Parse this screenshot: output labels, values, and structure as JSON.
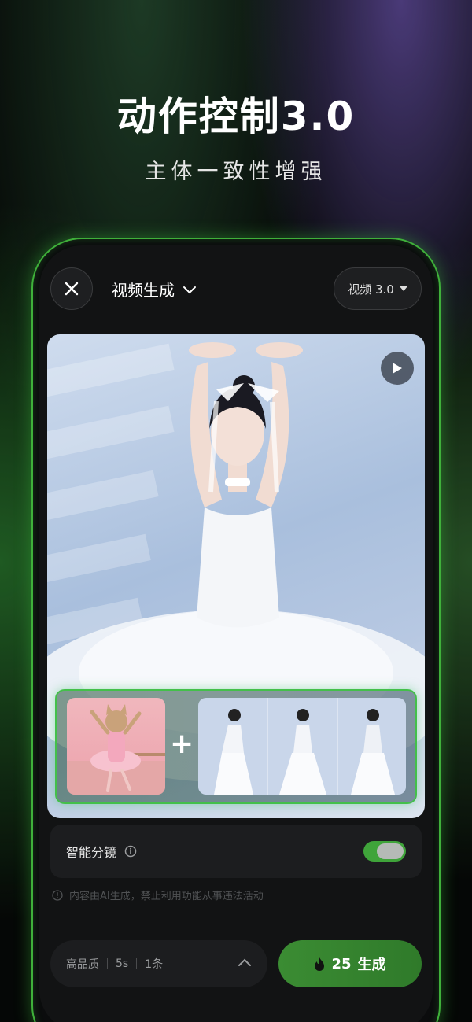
{
  "promo": {
    "headline": "动作控制3.0",
    "subline": "主体一致性增强"
  },
  "header": {
    "close_icon": "close-icon",
    "mode_title": "视频生成",
    "version_label": "视频 3.0"
  },
  "media": {
    "play_icon": "play-icon"
  },
  "combo": {
    "plus": "+"
  },
  "options": {
    "smart_shot_label": "智能分镜",
    "smart_shot_on": true
  },
  "disclaimer": "内容由AI生成，禁止利用功能从事违法活动",
  "footer": {
    "quality": "高品质",
    "duration": "5s",
    "count": "1条",
    "credits": "25",
    "generate_label": "生成"
  },
  "colors": {
    "accent": "#3fa43a",
    "glow": "#3fb03a"
  }
}
